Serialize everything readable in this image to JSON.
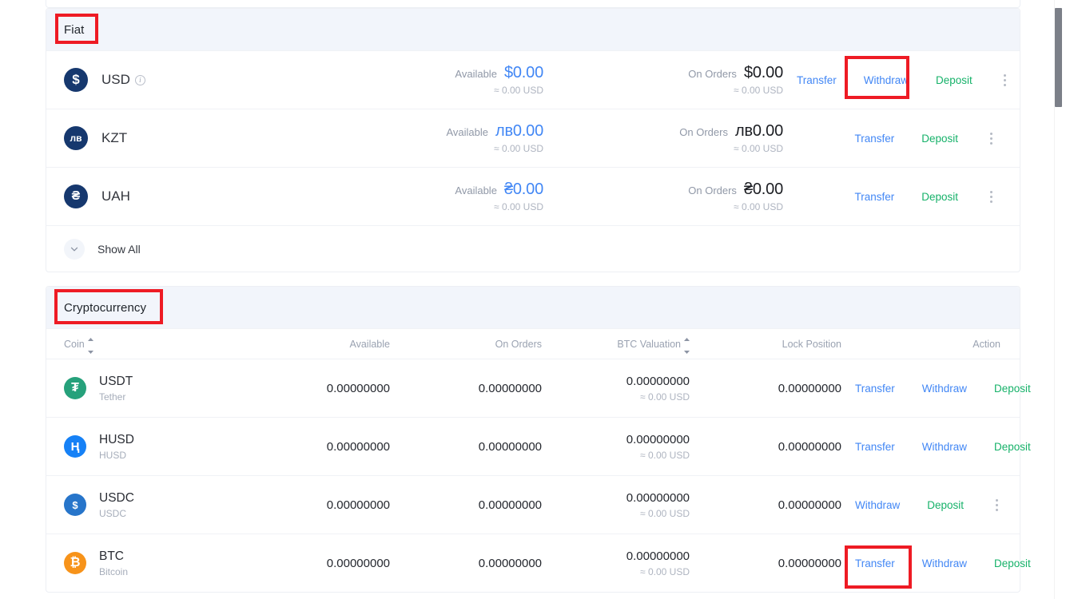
{
  "fiat_section": {
    "title": "Fiat",
    "rows": [
      {
        "symbol": "USD",
        "badge_glyph": "$",
        "has_info_icon": true,
        "available_label": "Available",
        "available_value": "$0.00",
        "available_sub": "≈ 0.00 USD",
        "onorders_label": "On Orders",
        "onorders_value": "$0.00",
        "onorders_sub": "≈ 0.00 USD",
        "actions": [
          "Transfer",
          "Withdraw",
          "Deposit"
        ]
      },
      {
        "symbol": "KZT",
        "badge_glyph": "лв",
        "has_info_icon": false,
        "available_label": "Available",
        "available_value": "лв0.00",
        "available_sub": "≈ 0.00 USD",
        "onorders_label": "On Orders",
        "onorders_value": "лв0.00",
        "onorders_sub": "≈ 0.00 USD",
        "actions": [
          "Transfer",
          "Deposit"
        ]
      },
      {
        "symbol": "UAH",
        "badge_glyph": "₴",
        "has_info_icon": false,
        "available_label": "Available",
        "available_value": "₴0.00",
        "available_sub": "≈ 0.00 USD",
        "onorders_label": "On Orders",
        "onorders_value": "₴0.00",
        "onorders_sub": "≈ 0.00 USD",
        "actions": [
          "Transfer",
          "Deposit"
        ]
      }
    ],
    "show_all_label": "Show All"
  },
  "crypto_section": {
    "title": "Cryptocurrency",
    "columns": {
      "coin": "Coin",
      "available": "Available",
      "on_orders": "On Orders",
      "btc_valuation": "BTC Valuation",
      "lock_position": "Lock Position",
      "action": "Action"
    },
    "rows": [
      {
        "symbol": "USDT",
        "name": "Tether",
        "badge_glyph": "₮",
        "available": "0.00000000",
        "on_orders": "0.00000000",
        "btc_valuation": "0.00000000",
        "btc_valuation_sub": "≈ 0.00 USD",
        "lock_position": "0.00000000",
        "actions": [
          "Transfer",
          "Withdraw",
          "Deposit"
        ]
      },
      {
        "symbol": "HUSD",
        "name": "HUSD",
        "badge_glyph": "Ⱨ",
        "available": "0.00000000",
        "on_orders": "0.00000000",
        "btc_valuation": "0.00000000",
        "btc_valuation_sub": "≈ 0.00 USD",
        "lock_position": "0.00000000",
        "actions": [
          "Transfer",
          "Withdraw",
          "Deposit"
        ]
      },
      {
        "symbol": "USDC",
        "name": "USDC",
        "badge_glyph": "$",
        "available": "0.00000000",
        "on_orders": "0.00000000",
        "btc_valuation": "0.00000000",
        "btc_valuation_sub": "≈ 0.00 USD",
        "lock_position": "0.00000000",
        "actions": [
          "Withdraw",
          "Deposit"
        ]
      },
      {
        "symbol": "BTC",
        "name": "Bitcoin",
        "badge_glyph": "₿",
        "available": "0.00000000",
        "on_orders": "0.00000000",
        "btc_valuation": "0.00000000",
        "btc_valuation_sub": "≈ 0.00 USD",
        "lock_position": "0.00000000",
        "actions": [
          "Transfer",
          "Withdraw",
          "Deposit"
        ]
      }
    ]
  },
  "colors": {
    "link_blue": "#4287f5",
    "deposit_green": "#17b26a",
    "band_bg": "#f2f5fb",
    "annotation_red": "#ee1b24"
  }
}
